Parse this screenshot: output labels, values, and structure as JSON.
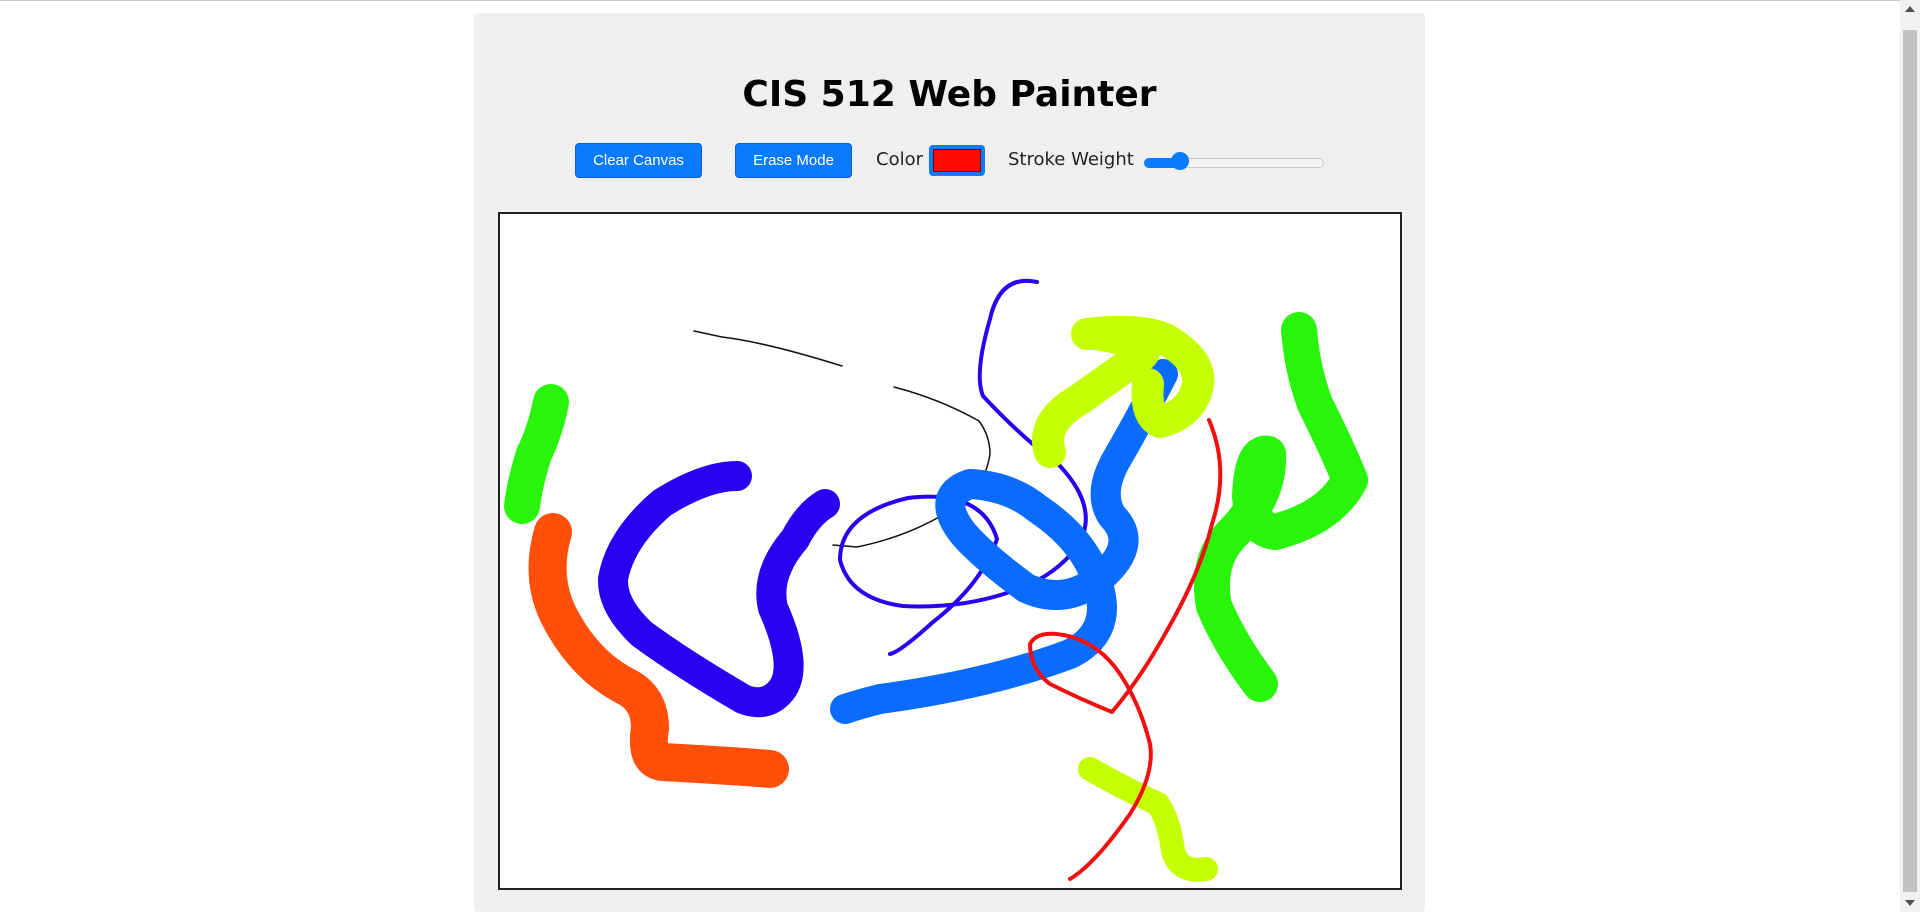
{
  "header": {
    "title": "CIS 512 Web Painter"
  },
  "toolbar": {
    "clear_label": "Clear Canvas",
    "erase_label": "Erase Mode",
    "color_label": "Color",
    "color_value": "#ff0a00",
    "stroke_label": "Stroke Weight",
    "stroke_fraction": 0.2
  },
  "colors": {
    "accent": "#0a7bff",
    "card_bg": "#efefef"
  }
}
